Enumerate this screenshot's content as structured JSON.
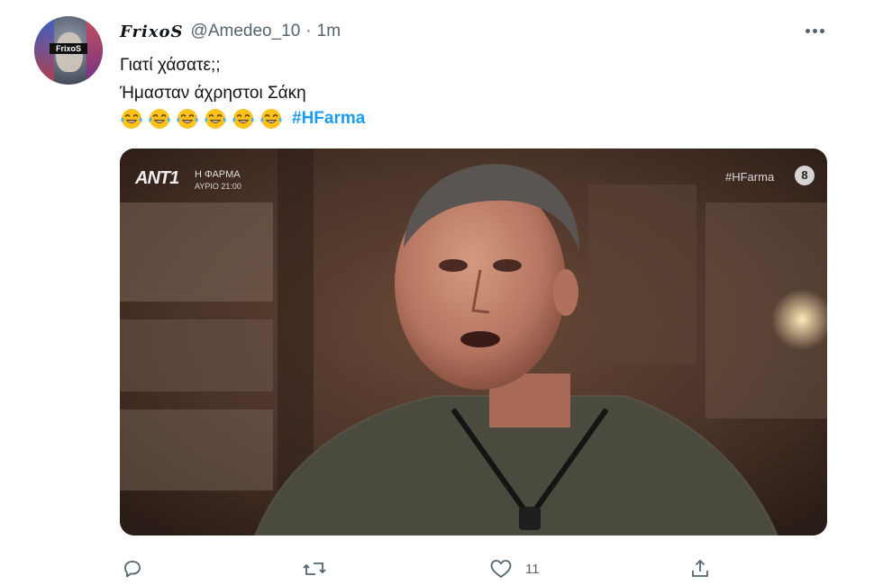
{
  "tweet": {
    "avatar_tag": "FrixoS",
    "display_name": "FrixoS",
    "handle": "@Amedeo_10",
    "separator": "·",
    "time": "1m",
    "lines": [
      "Γιατί χάσατε;;",
      "Ήμασταν άχρηστοι Σάκη"
    ],
    "emoji_count": 6,
    "emoji_name": "face-with-tears-of-joy",
    "hashtag": "#HFarma",
    "media": {
      "channel_logo": "ANT1",
      "show_title": "Η ΦΑΡΜΑ",
      "schedule": "ΑΥΡΙΟ 21:00",
      "corner_tag": "#HFarma",
      "rating": "8"
    },
    "actions": {
      "reply_icon": "reply-icon",
      "retweet_icon": "retweet-icon",
      "like_icon": "heart-icon",
      "like_count": "11",
      "share_icon": "share-icon"
    }
  },
  "colors": {
    "accent": "#1d9bf0",
    "text": "#0f1419",
    "muted": "#536471"
  }
}
